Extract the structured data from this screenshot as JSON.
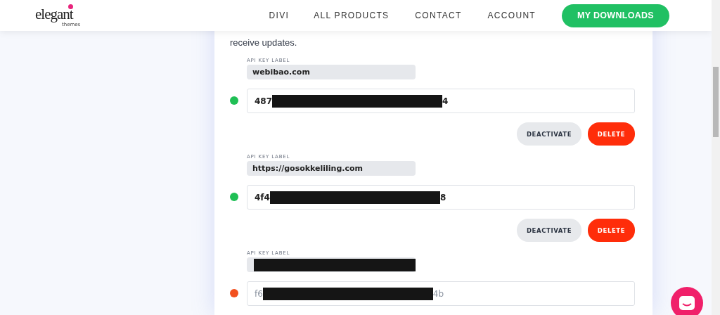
{
  "header": {
    "logo": {
      "word": "elegant",
      "sub": "themes"
    },
    "nav": [
      {
        "label": "DIVI"
      },
      {
        "label": "ALL PRODUCTS"
      },
      {
        "label": "CONTACT"
      },
      {
        "label": "ACCOUNT"
      }
    ],
    "cta": "MY DOWNLOADS"
  },
  "intro": "receive updates.",
  "api_keys": [
    {
      "label_caption": "API KEY LABEL",
      "label": "webibao.com",
      "label_redacted": false,
      "key_prefix": "487",
      "key_suffix": "4",
      "active": true,
      "color": "#1fbf55",
      "buttons": [
        "DEACTIVATE",
        "DELETE"
      ]
    },
    {
      "label_caption": "API KEY LABEL",
      "label": "https://gosokkeliling.com",
      "label_redacted": false,
      "key_prefix": "4f4",
      "key_suffix": "8",
      "active": true,
      "color": "#1fbf55",
      "buttons": [
        "DEACTIVATE",
        "DELETE"
      ]
    },
    {
      "label_caption": "API KEY LABEL",
      "label_redacted": true,
      "key_prefix": "f6",
      "key_suffix": "4b",
      "active": false,
      "color": "#f2501e"
    }
  ]
}
